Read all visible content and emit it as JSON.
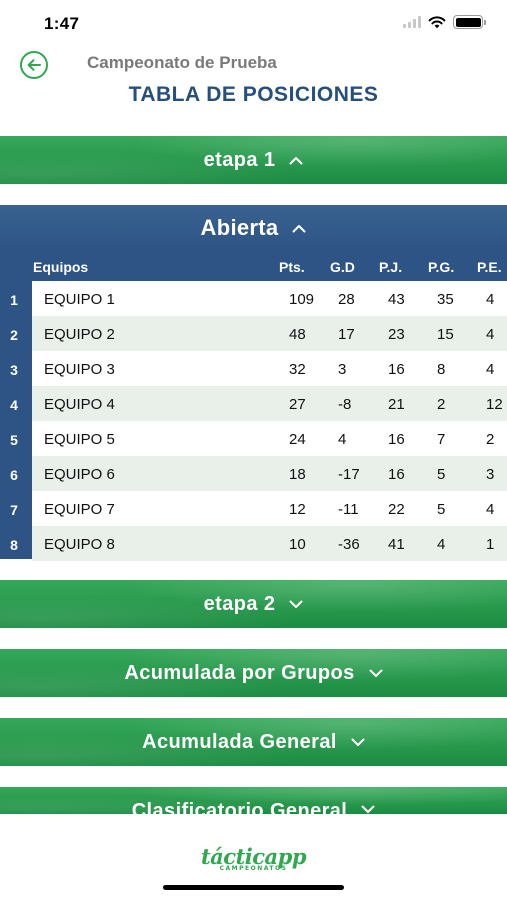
{
  "status_bar": {
    "time": "1:47"
  },
  "header": {
    "subtitle": "Campeonato de Prueba",
    "title": "TABLA DE POSICIONES"
  },
  "sections": {
    "etapa1": {
      "label": "etapa 1",
      "state": "expanded"
    },
    "etapa2": {
      "label": "etapa 2",
      "state": "collapsed"
    },
    "acumulada_grupos": {
      "label": "Acumulada por Grupos",
      "state": "collapsed"
    },
    "acumulada_general": {
      "label": "Acumulada General",
      "state": "collapsed"
    },
    "clasificatorio": {
      "label": "Clasificatorio General",
      "state": "collapsed"
    }
  },
  "group": {
    "label": "Abierta",
    "state": "expanded"
  },
  "table": {
    "columns": [
      "Equipos",
      "Pts.",
      "G.D",
      "P.J.",
      "P.G.",
      "P.E."
    ],
    "rows": [
      {
        "rank": "1",
        "team": "EQUIPO 1",
        "pts": "109",
        "gd": "28",
        "pj": "43",
        "pg": "35",
        "pe": "4"
      },
      {
        "rank": "2",
        "team": "EQUIPO 2",
        "pts": "48",
        "gd": "17",
        "pj": "23",
        "pg": "15",
        "pe": "4"
      },
      {
        "rank": "3",
        "team": "EQUIPO 3",
        "pts": "32",
        "gd": "3",
        "pj": "16",
        "pg": "8",
        "pe": "4"
      },
      {
        "rank": "4",
        "team": "EQUIPO 4",
        "pts": "27",
        "gd": "-8",
        "pj": "21",
        "pg": "2",
        "pe": "12"
      },
      {
        "rank": "5",
        "team": "EQUIPO 5",
        "pts": "24",
        "gd": "4",
        "pj": "16",
        "pg": "7",
        "pe": "2"
      },
      {
        "rank": "6",
        "team": "EQUIPO 6",
        "pts": "18",
        "gd": "-17",
        "pj": "16",
        "pg": "5",
        "pe": "3"
      },
      {
        "rank": "7",
        "team": "EQUIPO 7",
        "pts": "12",
        "gd": "-11",
        "pj": "22",
        "pg": "5",
        "pe": "4"
      },
      {
        "rank": "8",
        "team": "EQUIPO 8",
        "pts": "10",
        "gd": "-36",
        "pj": "41",
        "pg": "4",
        "pe": "1"
      }
    ]
  },
  "footer": {
    "logo_text": "tácticapp",
    "logo_sub": "CAMPEONATOS"
  },
  "colors": {
    "accent_green": "#2fa84f",
    "header_blue": "#2d5484",
    "title_blue": "#274f7a",
    "row_alt": "#e9f0e9"
  },
  "icons": {
    "back": "arrow-left-circle-icon",
    "collapse": "chevron-up-icon",
    "expand": "chevron-down-icon"
  }
}
